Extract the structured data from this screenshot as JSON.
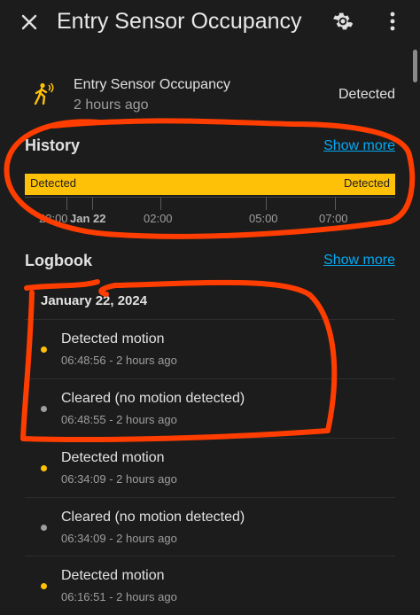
{
  "header": {
    "title": "Entry Sensor Occupancy",
    "close_icon": "close-icon",
    "settings_icon": "gear-icon",
    "more_icon": "more-vert-icon"
  },
  "entity": {
    "icon": "motion-sensor-icon",
    "name": "Entry Sensor Occupancy",
    "last_changed": "2 hours ago",
    "state": "Detected"
  },
  "history": {
    "title": "History",
    "show_more": "Show more",
    "bar_color": "#ffc107",
    "bar_labels": [
      "Detected",
      "Detected"
    ],
    "axis_labels": [
      "23:00",
      "Jan 22",
      "02:00",
      "05:00",
      "07:00"
    ]
  },
  "logbook": {
    "title": "Logbook",
    "show_more": "Show more",
    "date": "January 22, 2024",
    "entries": [
      {
        "message": "Detected motion",
        "time": "06:48:56 - 2 hours ago",
        "dot_color": "#ffc107"
      },
      {
        "message": "Cleared (no motion detected)",
        "time": "06:48:55 - 2 hours ago",
        "dot_color": "#9e9e9e"
      },
      {
        "message": "Detected motion",
        "time": "06:34:09 - 2 hours ago",
        "dot_color": "#ffc107"
      },
      {
        "message": "Cleared (no motion detected)",
        "time": "06:34:09 - 2 hours ago",
        "dot_color": "#9e9e9e"
      },
      {
        "message": "Detected motion",
        "time": "06:16:51 - 2 hours ago",
        "dot_color": "#ffc107"
      }
    ]
  },
  "colors": {
    "background": "#1c1c1c",
    "accent_link": "#03a9f4",
    "detected": "#ffc107",
    "cleared": "#9e9e9e",
    "annotation": "#ff3d00"
  }
}
